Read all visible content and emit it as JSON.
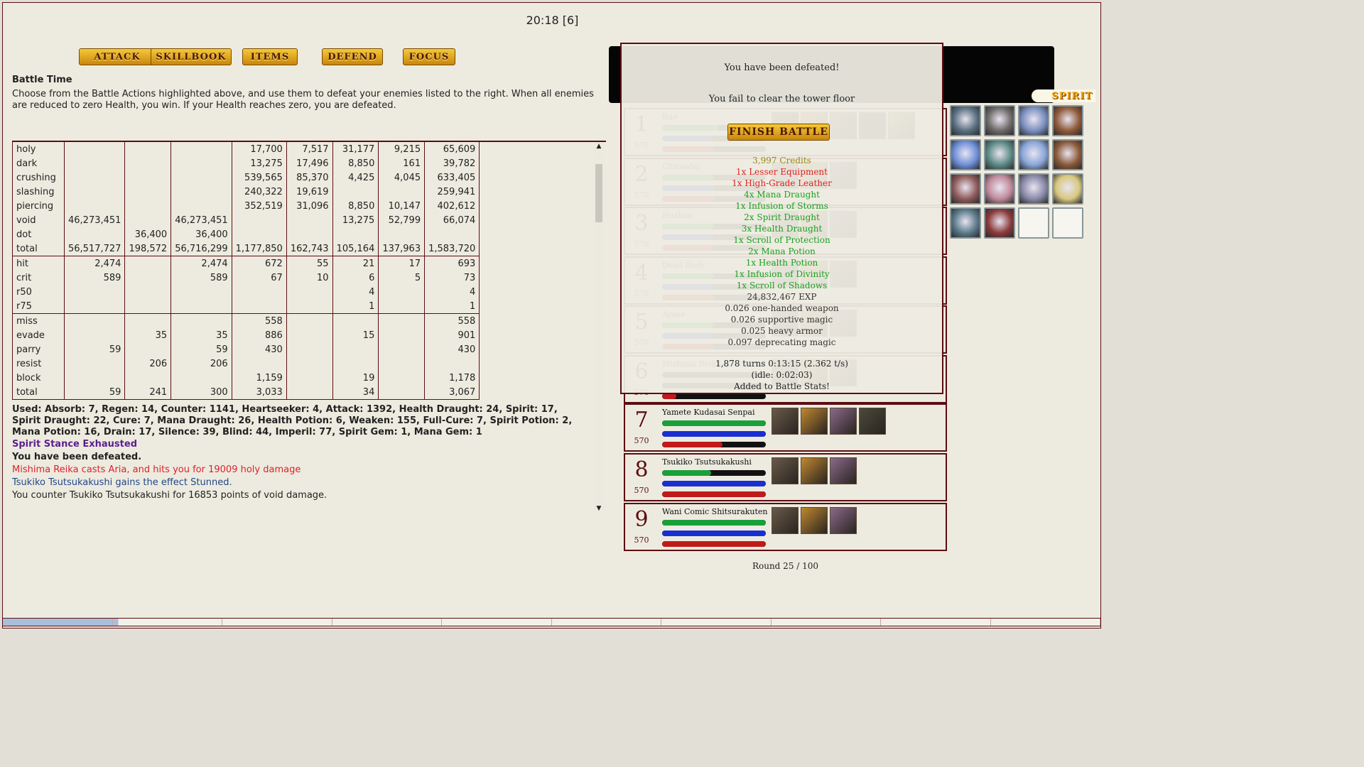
{
  "clock": "20:18 [6]",
  "actions": [
    "ATTACK",
    "SKILLBOOK",
    "ITEMS",
    "DEFEND",
    "FOCUS"
  ],
  "battle": {
    "title": "Battle Time",
    "description": "Choose from the Battle Actions highlighted above, and use them to defeat your enemies listed to the right. When all enemies are reduced to zero Health, you win. If your Health reaches zero, you are defeated."
  },
  "stats_table": {
    "groups": [
      [
        [
          "holy",
          "",
          "",
          "",
          "17,700",
          "7,517",
          "31,177",
          "9,215",
          "65,609"
        ],
        [
          "dark",
          "",
          "",
          "",
          "13,275",
          "17,496",
          "8,850",
          "161",
          "39,782"
        ],
        [
          "crushing",
          "",
          "",
          "",
          "539,565",
          "85,370",
          "4,425",
          "4,045",
          "633,405"
        ],
        [
          "slashing",
          "",
          "",
          "",
          "240,322",
          "19,619",
          "",
          "",
          "259,941"
        ],
        [
          "piercing",
          "",
          "",
          "",
          "352,519",
          "31,096",
          "8,850",
          "10,147",
          "402,612"
        ],
        [
          "void",
          "46,273,451",
          "",
          "46,273,451",
          "",
          "",
          "13,275",
          "52,799",
          "66,074"
        ],
        [
          "dot",
          "",
          "36,400",
          "36,400",
          "",
          "",
          "",
          "",
          ""
        ],
        [
          "total",
          "56,517,727",
          "198,572",
          "56,716,299",
          "1,177,850",
          "162,743",
          "105,164",
          "137,963",
          "1,583,720"
        ]
      ],
      [
        [
          "hit",
          "2,474",
          "",
          "2,474",
          "672",
          "55",
          "21",
          "17",
          "693"
        ],
        [
          "crit",
          "589",
          "",
          "589",
          "67",
          "10",
          "6",
          "5",
          "73"
        ],
        [
          "r50",
          "",
          "",
          "",
          "",
          "",
          "4",
          "",
          "4"
        ],
        [
          "r75",
          "",
          "",
          "",
          "",
          "",
          "1",
          "",
          "1"
        ]
      ],
      [
        [
          "miss",
          "",
          "",
          "",
          "558",
          "",
          "",
          "",
          "558"
        ],
        [
          "evade",
          "",
          "35",
          "35",
          "886",
          "",
          "15",
          "",
          "901"
        ],
        [
          "parry",
          "59",
          "",
          "59",
          "430",
          "",
          "",
          "",
          "430"
        ],
        [
          "resist",
          "",
          "206",
          "206",
          "",
          "",
          "",
          "",
          ""
        ],
        [
          "block",
          "",
          "",
          "",
          "1,159",
          "",
          "19",
          "",
          "1,178"
        ],
        [
          "total",
          "59",
          "241",
          "300",
          "3,033",
          "",
          "34",
          "",
          "3,067"
        ]
      ]
    ]
  },
  "log": {
    "used": "Used: Absorb: 7, Regen: 14, Counter: 1141, Heartseeker: 4, Attack: 1392, Health Draught: 24, Spirit: 17, Spirit Draught: 22, Cure: 7, Mana Draught: 26, Health Potion: 6, Weaken: 155, Full-Cure: 7, Spirit Potion: 2, Mana Potion: 16, Drain: 17, Silence: 39, Blind: 44, Imperil: 77, Spirit Gem: 1, Mana Gem: 1",
    "lines": [
      {
        "text": "Spirit Stance Exhausted",
        "style": "purple"
      },
      {
        "text": "You have been defeated.",
        "style": "black"
      },
      {
        "text": "Mishima Reika casts Aria, and hits you for 19009 holy damage",
        "style": "red"
      },
      {
        "text": "Tsukiko Tsutsukakushi gains the effect Stunned.",
        "style": "blue"
      },
      {
        "text": "You counter Tsukiko Tsutsukakushi for 16853 points of void damage.",
        "style": "black-plain"
      }
    ]
  },
  "monsters": [
    {
      "num": "1",
      "name": "Rue",
      "level": "570",
      "hp": 0.55,
      "mp": 0.5,
      "sp": 0.5,
      "icons": 5
    },
    {
      "num": "2",
      "name": "Chitsudai",
      "level": "570",
      "hp": 0.5,
      "mp": 0.5,
      "sp": 0.5,
      "icons": 3
    },
    {
      "num": "3",
      "name": "Hushan",
      "level": "570",
      "hp": 0.5,
      "mp": 0.5,
      "sp": 0.5,
      "icons": 3
    },
    {
      "num": "4",
      "name": "Dead Body",
      "level": "570",
      "hp": 0.5,
      "mp": 0.5,
      "sp": 0.5,
      "icons": 3
    },
    {
      "num": "5",
      "name": "Ayase",
      "level": "570",
      "hp": 0.5,
      "mp": 0.5,
      "sp": 0.5,
      "icons": 3
    },
    {
      "num": "6",
      "name": "Mishima Reika",
      "level": "570",
      "hp": 0.0,
      "mp": 0.0,
      "sp": 0.14,
      "icons": 3
    },
    {
      "num": "7",
      "name": "Yamete Kudasai Senpai",
      "level": "570",
      "hp": 1.0,
      "mp": 1.0,
      "sp": 0.58,
      "icons": 4
    },
    {
      "num": "8",
      "name": "Tsukiko Tsutsukakushi",
      "level": "570",
      "hp": 0.47,
      "mp": 1.0,
      "sp": 1.0,
      "icons": 3
    },
    {
      "num": "9",
      "name": "Wani Comic Shitsurakuten",
      "level": "570",
      "hp": 1.0,
      "mp": 1.0,
      "sp": 1.0,
      "icons": 3
    }
  ],
  "round": "Round 25 / 100",
  "spirit_label": "SPIRIT",
  "skill_colors": [
    "#5a6f80",
    "#6e6a68",
    "#7a8fbf",
    "#8e5a3a",
    "#6e8fd8",
    "#5c8a86",
    "#8aa6d8",
    "#8a5a3a",
    "#8e5a5a",
    "#c08a9a",
    "#8a8aa8",
    "#d8c880",
    "#5a7a8a",
    "#8a3a3a",
    "",
    ""
  ],
  "overlay": {
    "defeated": "You have been defeated!",
    "fail": "You fail to clear the tower floor",
    "finish_button": "FINISH BATTLE",
    "rewards": [
      {
        "text": "3,997 Credits",
        "style": "gold"
      },
      {
        "text": "1x Lesser Equipment",
        "style": "red"
      },
      {
        "text": "1x High-Grade Leather",
        "style": "red"
      },
      {
        "text": "4x Mana Draught",
        "style": "green"
      },
      {
        "text": "1x Infusion of Storms",
        "style": "green"
      },
      {
        "text": "2x Spirit Draught",
        "style": "green"
      },
      {
        "text": "3x Health Draught",
        "style": "green"
      },
      {
        "text": "1x Scroll of Protection",
        "style": "green"
      },
      {
        "text": "2x Mana Potion",
        "style": "green"
      },
      {
        "text": "1x Health Potion",
        "style": "green"
      },
      {
        "text": "1x Infusion of Divinity",
        "style": "green"
      },
      {
        "text": "1x Scroll of Shadows",
        "style": "green"
      },
      {
        "text": "24,832,467 EXP",
        "style": "dark"
      },
      {
        "text": "0.026 one-handed weapon",
        "style": "dark"
      },
      {
        "text": "0.026 supportive magic",
        "style": "dark"
      },
      {
        "text": "0.025 heavy armor",
        "style": "dark"
      },
      {
        "text": "0.097 deprecating magic",
        "style": "dark"
      }
    ],
    "turns": "1,878 turns 0:13:15 (2.362 t/s)",
    "idle": "(idle: 0:02:03)",
    "added": "Added to Battle Stats!"
  },
  "progress": {
    "filled": 0.105,
    "segments": 10
  }
}
